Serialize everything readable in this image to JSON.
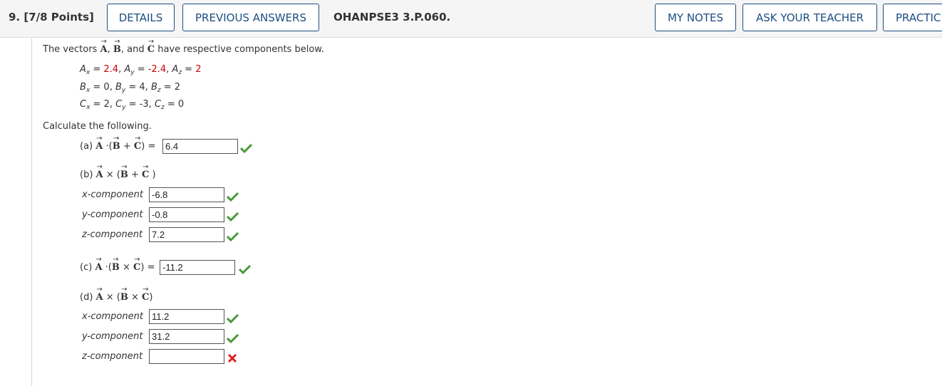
{
  "header": {
    "question_number": "9.",
    "points": "[7/8 Points]",
    "details_label": "DETAILS",
    "previous_answers_label": "PREVIOUS ANSWERS",
    "problem_code": "OHANPSE3 3.P.060.",
    "my_notes_label": "MY NOTES",
    "ask_teacher_label": "ASK YOUR TEACHER",
    "practice_label": "PRACTIC"
  },
  "problem": {
    "intro_prefix": "The vectors",
    "intro_comma": ",",
    "intro_and": ", and",
    "intro_suffix": "have respective components below.",
    "vec_a": "A",
    "vec_b": "B",
    "vec_c": "C",
    "A": {
      "x": "2.4",
      "y": "-2.4",
      "z": "2"
    },
    "B": {
      "x": "0",
      "y": "4",
      "z": "2"
    },
    "C": {
      "x": "2",
      "y": "-3",
      "z": "0"
    },
    "calculate": "Calculate the following."
  },
  "parts": {
    "a": {
      "label": "(a)",
      "answer": "6.4"
    },
    "b": {
      "label": "(b)",
      "x_label": "x-component",
      "y_label": "y-component",
      "z_label": "z-component",
      "x": "-6.8",
      "y": "-0.8",
      "z": "7.2"
    },
    "c": {
      "label": "(c)",
      "answer": "-11.2"
    },
    "d": {
      "label": "(d)",
      "x_label": "x-component",
      "y_label": "y-component",
      "z_label": "z-component",
      "x": "11.2",
      "y": "31.2",
      "z": ""
    }
  },
  "colors": {
    "accent": "#1c4e80",
    "correct": "#4a9a3a",
    "incorrect": "#e02020",
    "given_value": "#cc0000"
  }
}
